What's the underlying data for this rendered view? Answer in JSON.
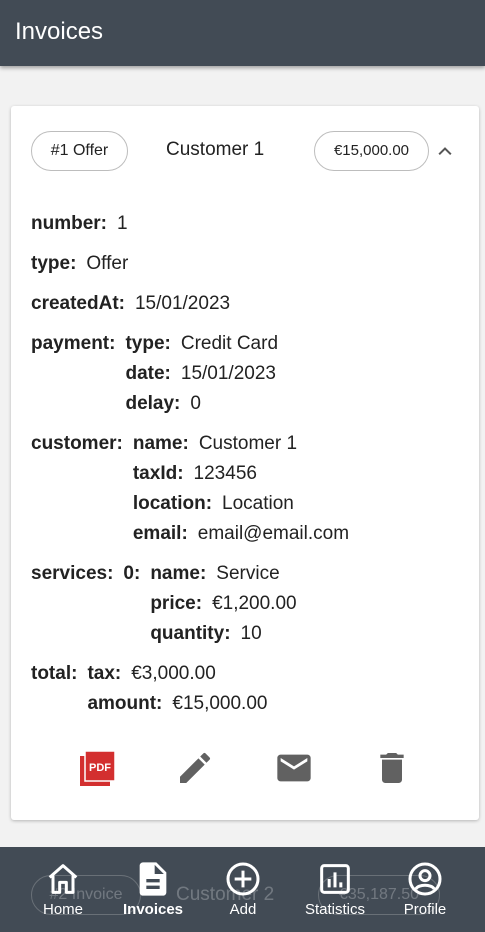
{
  "appbar": {
    "title": "Invoices"
  },
  "invoice": {
    "chip_label": "#1 Offer",
    "customer_name": "Customer 1",
    "amount_chip": "€15,000.00",
    "fields": {
      "number": {
        "label": "number:",
        "value": "1"
      },
      "type": {
        "label": "type:",
        "value": "Offer"
      },
      "createdAt": {
        "label": "createdAt:",
        "value": "15/01/2023"
      },
      "payment": {
        "label": "payment:",
        "type": {
          "label": "type:",
          "value": "Credit Card"
        },
        "date": {
          "label": "date:",
          "value": "15/01/2023"
        },
        "delay": {
          "label": "delay:",
          "value": "0"
        }
      },
      "customer": {
        "label": "customer:",
        "name": {
          "label": "name:",
          "value": "Customer 1"
        },
        "taxId": {
          "label": "taxId:",
          "value": "123456"
        },
        "location": {
          "label": "location:",
          "value": "Location"
        },
        "email": {
          "label": "email:",
          "value": "email@email.com"
        }
      },
      "services": {
        "label": "services:",
        "index": "0:",
        "name": {
          "label": "name:",
          "value": "Service"
        },
        "price": {
          "label": "price:",
          "value": "€1,200.00"
        },
        "quantity": {
          "label": "quantity:",
          "value": "10"
        }
      },
      "total": {
        "label": "total:",
        "tax": {
          "label": "tax:",
          "value": "€3,000.00"
        },
        "amount": {
          "label": "amount:",
          "value": "€15,000.00"
        }
      }
    },
    "actions": {
      "pdf_icon": "pdf-icon",
      "edit_icon": "edit-icon",
      "email_icon": "mail-icon",
      "delete_icon": "trash-icon"
    }
  },
  "next_invoice": {
    "chip_label": "#2 Invoice",
    "customer_name": "Customer 2",
    "amount_chip": "€35,187.50"
  },
  "bottom_nav": [
    {
      "label": "Home",
      "icon": "home-icon",
      "active": false
    },
    {
      "label": "Invoices",
      "icon": "document-icon",
      "active": true
    },
    {
      "label": "Add",
      "icon": "add-circle-icon",
      "active": false
    },
    {
      "label": "Statistics",
      "icon": "chart-icon",
      "active": false
    },
    {
      "label": "Profile",
      "icon": "profile-icon",
      "active": false
    }
  ],
  "colors": {
    "appbar": "#424b55",
    "pdf_red": "#d32f2f",
    "icon_gray": "#616161"
  }
}
